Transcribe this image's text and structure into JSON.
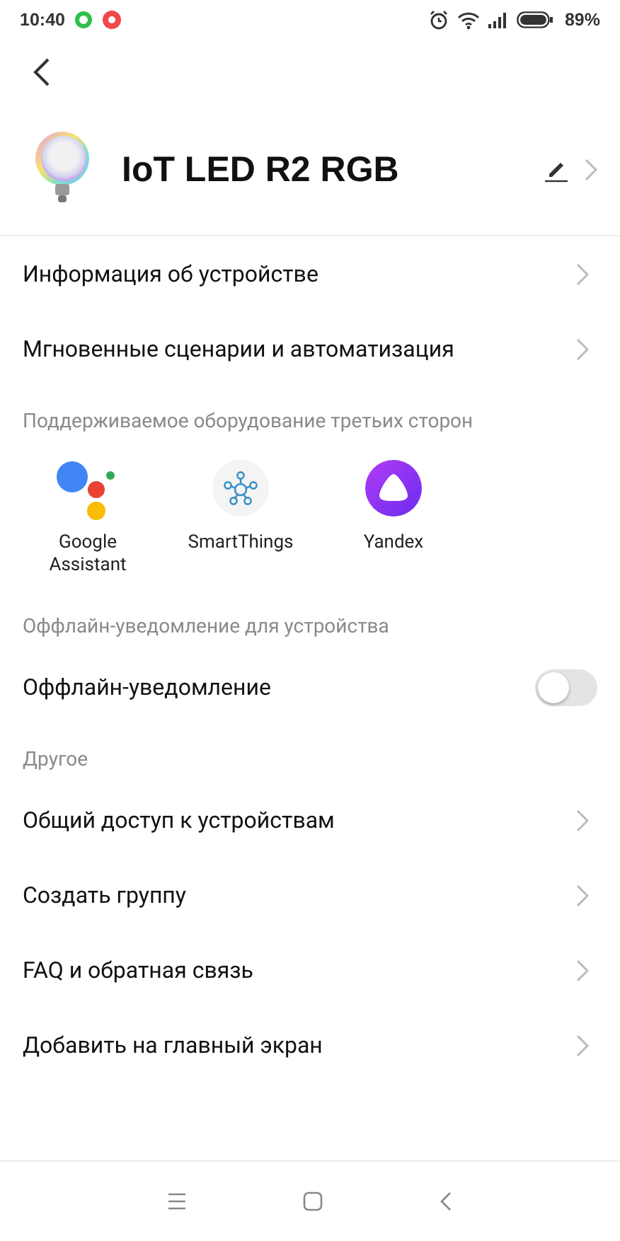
{
  "status_bar": {
    "time": "10:40",
    "battery": "89%"
  },
  "device": {
    "name": "IoT LED R2 RGB"
  },
  "items": [
    {
      "kind": "link",
      "label": "Информация об устройстве"
    },
    {
      "kind": "link",
      "label": "Мгновенные сценарии и автоматизация"
    },
    {
      "kind": "section",
      "label": "Поддерживаемое оборудование третьих сторон"
    },
    {
      "kind": "integrations",
      "services": [
        {
          "kind": "google",
          "label": "Google Assistant"
        },
        {
          "kind": "smartthings",
          "label": "SmartThings"
        },
        {
          "kind": "yandex",
          "label": "Yandex"
        }
      ]
    },
    {
      "kind": "section",
      "label": "Оффлайн-уведомление для устройства"
    },
    {
      "kind": "toggle",
      "label": "Оффлайн-уведомление",
      "on": false
    },
    {
      "kind": "section",
      "label": "Другое"
    },
    {
      "kind": "link",
      "label": "Общий доступ к устройствам"
    },
    {
      "kind": "link",
      "label": "Создать группу"
    },
    {
      "kind": "link",
      "label": "FAQ и обратная связь"
    },
    {
      "kind": "link",
      "label": "Добавить на главный экран"
    }
  ]
}
